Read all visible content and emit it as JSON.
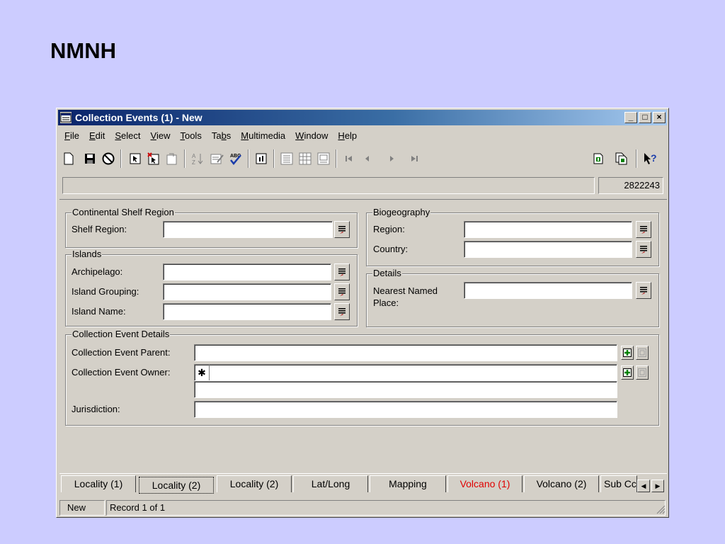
{
  "slide_title": "NMNH",
  "window": {
    "title": "Collection Events (1) - New",
    "controls": [
      "_",
      "□",
      "×"
    ]
  },
  "menu": [
    {
      "pre": "",
      "u": "F",
      "post": "ile"
    },
    {
      "pre": "",
      "u": "E",
      "post": "dit"
    },
    {
      "pre": "",
      "u": "S",
      "post": "elect"
    },
    {
      "pre": "",
      "u": "V",
      "post": "iew"
    },
    {
      "pre": "",
      "u": "T",
      "post": "ools"
    },
    {
      "pre": "Ta",
      "u": "b",
      "post": "s"
    },
    {
      "pre": "",
      "u": "M",
      "post": "ultimedia"
    },
    {
      "pre": "",
      "u": "W",
      "post": "indow"
    },
    {
      "pre": "",
      "u": "H",
      "post": "elp"
    }
  ],
  "toolbar_icons": [
    "new-icon",
    "save-icon",
    "cancel-icon",
    "select-icon",
    "delete-select-icon",
    "copy-icon",
    "sort-icon",
    "edit-icon",
    "spell-check-icon",
    "details-icon",
    "list-view-icon",
    "grid-view-icon",
    "image-view-icon",
    "first-record-icon",
    "prev-record-icon",
    "next-record-icon",
    "last-record-icon",
    "report-icon",
    "copy-report-icon",
    "help-icon"
  ],
  "record_id": "2822243",
  "continental_shelf": {
    "legend": "Continental Shelf Region",
    "shelf_region_label": "Shelf Region:",
    "shelf_region_value": ""
  },
  "islands": {
    "legend": "Islands",
    "archipelago_label": "Archipelago:",
    "island_grouping_label": "Island Grouping:",
    "island_name_label": "Island Name:"
  },
  "biogeography": {
    "legend": "Biogeography",
    "region_label": "Region:",
    "country_label": "Country:"
  },
  "details": {
    "legend": "Details",
    "nearest_label": "Nearest Named\nPlace:"
  },
  "ce_details": {
    "legend": "Collection Event Details",
    "parent_label": "Collection Event Parent:",
    "owner_label": "Collection Event Owner:",
    "owner_marker": "✱",
    "jurisdiction_label": "Jurisdiction:"
  },
  "tabs": [
    {
      "label": "Locality (1)",
      "active": false,
      "red": false
    },
    {
      "label": "Locality (2)",
      "active": true,
      "red": false
    },
    {
      "label": "Locality (2)",
      "active": false,
      "red": false
    },
    {
      "label": "Lat/Long",
      "active": false,
      "red": false
    },
    {
      "label": "Mapping",
      "active": false,
      "red": false
    },
    {
      "label": "Volcano (1)",
      "active": false,
      "red": true
    },
    {
      "label": "Volcano (2)",
      "active": false,
      "red": false
    },
    {
      "label": "Sub Cc",
      "active": false,
      "red": false
    }
  ],
  "status": {
    "mode": "New",
    "record": "Record 1 of 1"
  },
  "colors": {
    "slide_bg": "#ccccff",
    "window_bg": "#d4d0c8",
    "title_start": "#0a246a",
    "red_tab": "#e00000"
  }
}
